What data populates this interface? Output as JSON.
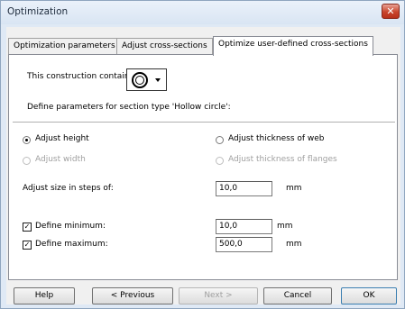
{
  "window": {
    "title": "Optimization",
    "close_label": "x"
  },
  "tabs": [
    {
      "label": "Optimization parameters",
      "active": false
    },
    {
      "label": "Adjust cross-sections",
      "active": false
    },
    {
      "label": "Optimize user-defined cross-sections",
      "active": true
    }
  ],
  "panel": {
    "construction_label": "This construction contains",
    "selected_shape_icon": "hollow-circle-icon",
    "define_params_label": "Define parameters for section type 'Hollow circle':",
    "adjust_height": {
      "label": "Adjust height",
      "checked": true,
      "enabled": true
    },
    "adjust_thickness_web": {
      "label": "Adjust thickness of web",
      "checked": false,
      "enabled": true
    },
    "adjust_width": {
      "label": "Adjust width",
      "checked": false,
      "enabled": false
    },
    "adjust_thickness_flanges": {
      "label": "Adjust thickness of flanges",
      "checked": false,
      "enabled": false
    },
    "steps": {
      "label": "Adjust size in steps of:",
      "value": "10,0",
      "unit": "mm"
    },
    "minimum": {
      "label": "Define minimum:",
      "checked": true,
      "value": "10,0",
      "unit": "mm"
    },
    "maximum": {
      "label": "Define maximum:",
      "checked": true,
      "value": "500,0",
      "unit": "mm"
    }
  },
  "buttons": {
    "help": "Help",
    "previous": "< Previous",
    "next": "Next >",
    "cancel": "Cancel",
    "ok": "OK"
  }
}
